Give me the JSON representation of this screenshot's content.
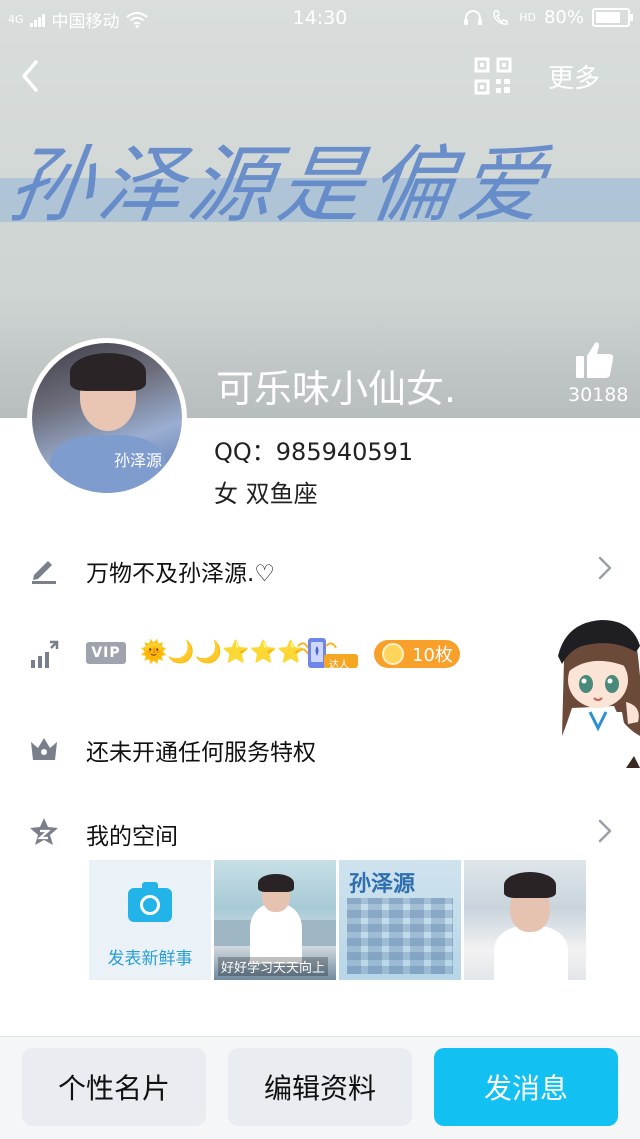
{
  "status_bar": {
    "signal_label": "4G",
    "carrier": "中国移动",
    "time": "14:30",
    "hd_label": "HD",
    "battery": "80%",
    "battery_level": 0.8
  },
  "cover": {
    "art_text": "孙泽源是偏爱"
  },
  "nav": {
    "more_label": "更多"
  },
  "profile": {
    "avatar_tag": "孙泽源",
    "nickname": "可乐味小仙女.",
    "like_count": "30188",
    "qq": "QQ：985940591",
    "info": "女  双鱼座"
  },
  "rows": {
    "signature": "万物不及孙泽源.♡",
    "vip_label": "VIP",
    "level_icons": "🌞🌙🌙⭐⭐⭐",
    "daren_label": "达人",
    "coins": "10枚",
    "privilege": "还未开通任何服务特权",
    "space": "我的空间"
  },
  "space": {
    "post_label": "发表新鲜事",
    "photo1_caption": "好好学习天天向上",
    "photo2_title": "孙泽源"
  },
  "buttons": {
    "card": "个性名片",
    "edit": "编辑资料",
    "message": "发消息"
  },
  "colors": {
    "accent": "#13c0f2",
    "coin": "#f9a02b",
    "vip": "#9fa3ad"
  }
}
